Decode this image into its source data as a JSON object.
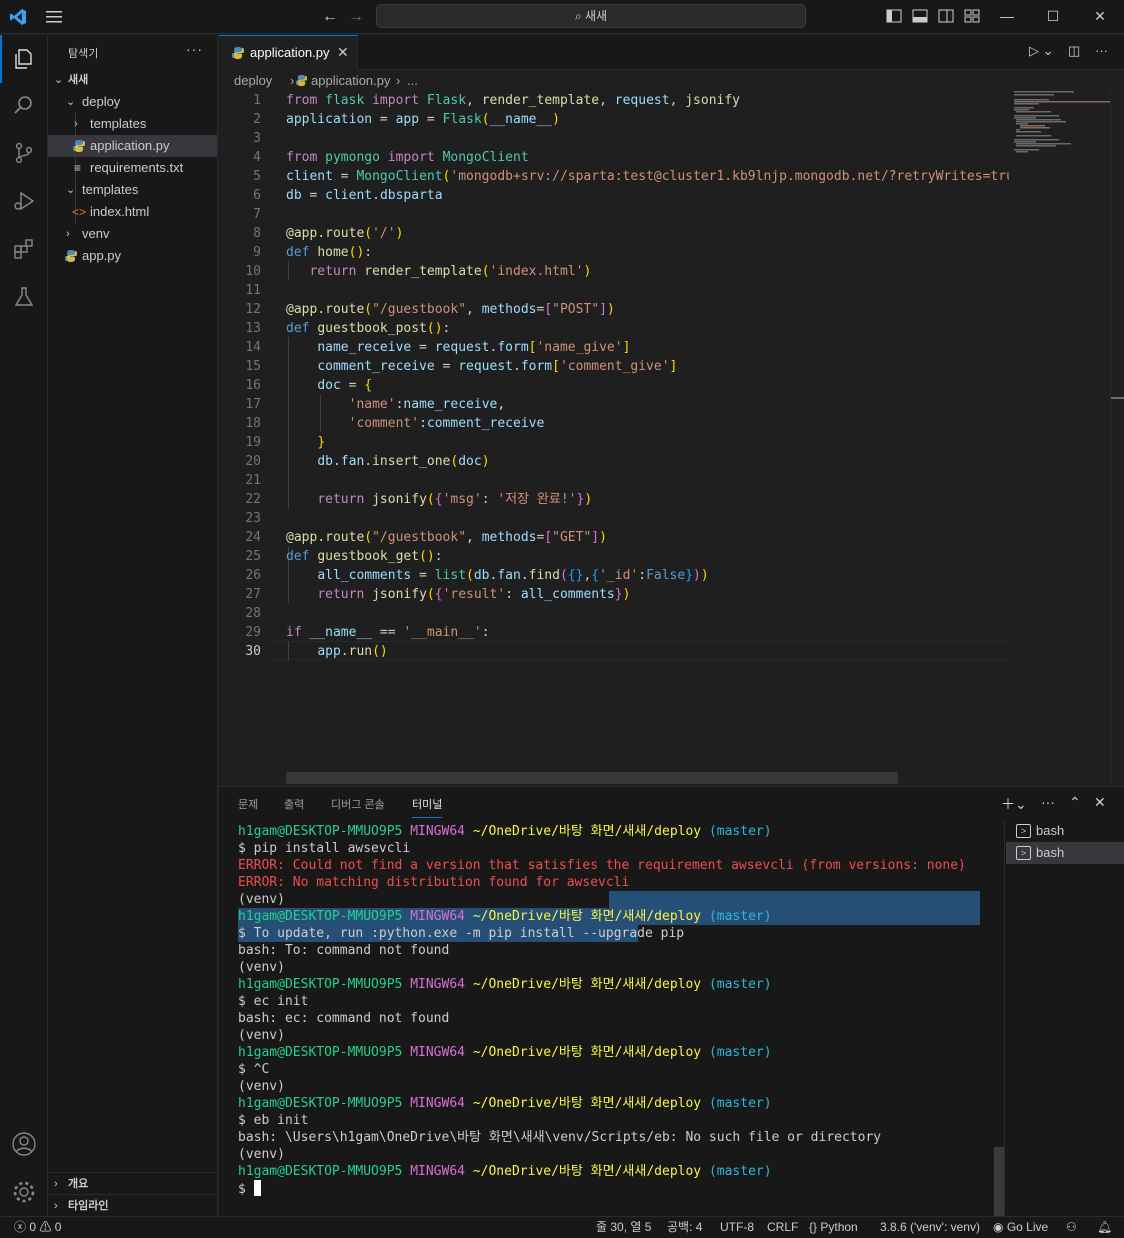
{
  "titlebar": {
    "search_label": "새새"
  },
  "explorer": {
    "title": "탐색기",
    "more": "···",
    "root": "새새",
    "items": [
      {
        "label": "deploy"
      },
      {
        "label": "templates"
      },
      {
        "label": "application.py"
      },
      {
        "label": "requirements.txt"
      },
      {
        "label": "templates"
      },
      {
        "label": "index.html"
      },
      {
        "label": "venv"
      },
      {
        "label": "app.py"
      }
    ],
    "outline_label": "개요",
    "timeline_label": "타임라인"
  },
  "editor": {
    "tab_label": "application.py",
    "breadcrumb": [
      "deploy",
      "application.py",
      "..."
    ],
    "current_line": 30
  },
  "panel": {
    "tabs": [
      "문제",
      "출력",
      "디버그 콘솔",
      "터미널"
    ],
    "active_tab": "터미널",
    "terminals": [
      "bash",
      "bash"
    ],
    "prompt": {
      "user": "h1gam@DESKTOP-MMUO9P5",
      "shell": "MINGW64",
      "path": "~/OneDrive/바탕 화면/새새/deploy",
      "branch": "(master)"
    },
    "lines": {
      "l2": "$ pip install awsevcli",
      "l3": "ERROR: Could not find a version that satisfies the requirement awsevcli (from versions: none)",
      "l4": "ERROR: No matching distribution found for awsevcli",
      "venv": "(venv)",
      "l6": "$ To update, run :python.exe -m pip install --upgrade pip",
      "l7": "bash: To: command not found",
      "l10": "$ ec init",
      "l11": "bash: ec: command not found",
      "l14": "$ ^C",
      "l17": "$ eb init",
      "l18": "bash: \\Users\\h1gam\\OneDrive\\바탕 화면\\새새\\venv/Scripts/eb: No such file or directory",
      "l21": "$ "
    }
  },
  "statusbar": {
    "errors": "0",
    "warnings": "0",
    "position": "줄 30, 열 5",
    "spaces": "공백: 4",
    "encoding": "UTF-8",
    "eol": "CRLF",
    "language": "Python",
    "interpreter": "3.8.6 ('venv': venv)",
    "golive": "Go Live"
  },
  "colors": {
    "accent": "#0078d4",
    "keyword": "#569cd6",
    "string": "#ce9178",
    "function": "#dcdcaa",
    "prompt_user": "#23d18b",
    "prompt_shell": "#d670d6",
    "prompt_path": "#f5f543",
    "prompt_branch": "#29b8db",
    "error": "#f14c4c"
  }
}
